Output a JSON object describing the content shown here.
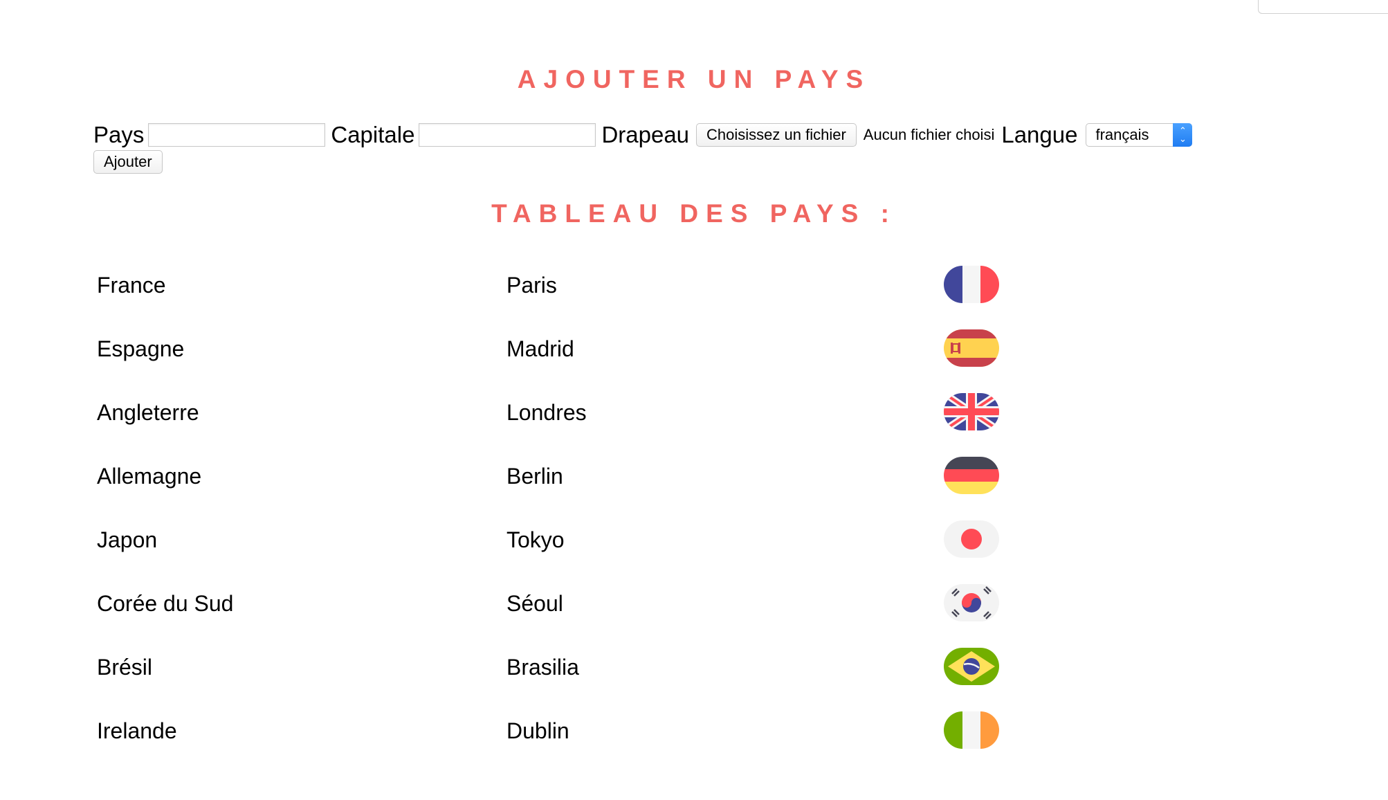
{
  "headings": {
    "add_country": "AJOUTER UN PAYS",
    "table": "TABLEAU DES PAYS :"
  },
  "form": {
    "country_label": "Pays",
    "country_value": "",
    "capital_label": "Capitale",
    "capital_value": "",
    "flag_label": "Drapeau",
    "file_button_label": "Choisissez un fichier",
    "no_file_text": "Aucun fichier choisi",
    "language_label": "Langue",
    "language_selected": "français",
    "submit_label": "Ajouter"
  },
  "countries": [
    {
      "country": "France",
      "capital": "Paris",
      "flag_icon": "france-flag-icon"
    },
    {
      "country": "Espagne",
      "capital": "Madrid",
      "flag_icon": "spain-flag-icon"
    },
    {
      "country": "Angleterre",
      "capital": "Londres",
      "flag_icon": "uk-flag-icon"
    },
    {
      "country": "Allemagne",
      "capital": "Berlin",
      "flag_icon": "germany-flag-icon"
    },
    {
      "country": "Japon",
      "capital": "Tokyo",
      "flag_icon": "japan-flag-icon"
    },
    {
      "country": "Corée du Sud",
      "capital": "Séoul",
      "flag_icon": "south-korea-flag-icon"
    },
    {
      "country": "Brésil",
      "capital": "Brasilia",
      "flag_icon": "brazil-flag-icon"
    },
    {
      "country": "Irelande",
      "capital": "Dublin",
      "flag_icon": "ireland-flag-icon"
    }
  ],
  "colors": {
    "heading": "#f06560",
    "select_accent": "#1f7cf2"
  }
}
